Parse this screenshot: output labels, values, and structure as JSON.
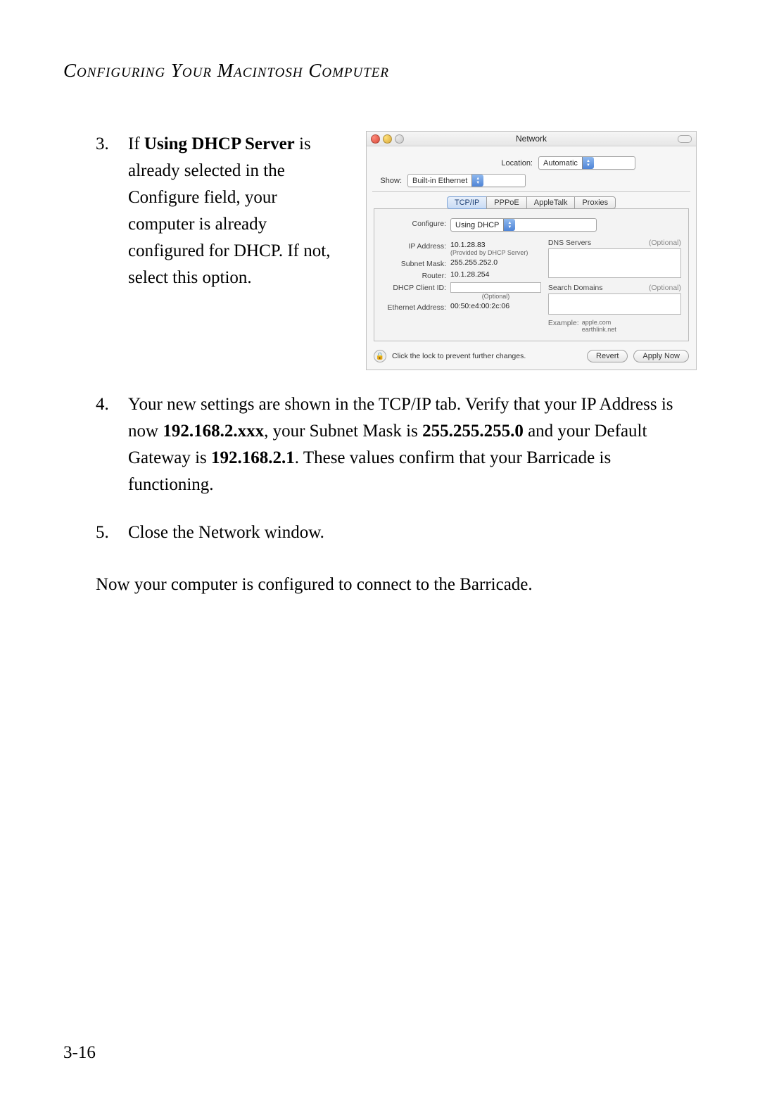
{
  "header": {
    "title": "Configuring Your Macintosh Computer"
  },
  "steps": {
    "s3": {
      "num": "3.",
      "lead": "If ",
      "bold": "Using DHCP Server",
      "rest": " is already selected in the Configure field, your computer is already configured for DHCP. If not, select this option."
    },
    "s4": {
      "num": "4.",
      "t1": "Your new settings are shown in the TCP/IP tab. Verify that your IP Address is now ",
      "b1": "192.168.2.xxx",
      "t2": ", your Subnet Mask is ",
      "b2": "255.255.255.0",
      "t3": " and your Default Gateway is ",
      "b3": "192.168.2.1",
      "t4": ". These values confirm that your Barricade is functioning."
    },
    "s5": {
      "num": "5.",
      "text": "Close the Network window."
    }
  },
  "closing": "Now your computer is configured to connect to the Barricade.",
  "pageNumber": "3-16",
  "mac": {
    "windowTitle": "Network",
    "location": {
      "label": "Location:",
      "value": "Automatic"
    },
    "show": {
      "label": "Show:",
      "value": "Built-in Ethernet"
    },
    "tabs": [
      "TCP/IP",
      "PPPoE",
      "AppleTalk",
      "Proxies"
    ],
    "configure": {
      "label": "Configure:",
      "value": "Using DHCP"
    },
    "ip": {
      "label": "IP Address:",
      "value": "10.1.28.83",
      "note": "(Provided by DHCP Server)"
    },
    "subnet": {
      "label": "Subnet Mask:",
      "value": "255.255.252.0"
    },
    "router": {
      "label": "Router:",
      "value": "10.1.28.254"
    },
    "dhcpClient": {
      "label": "DHCP Client ID:",
      "note": "(Optional)"
    },
    "ethernet": {
      "label": "Ethernet Address:",
      "value": "00:50:e4:00:2c:06"
    },
    "dns": {
      "label": "DNS Servers",
      "opt": "(Optional)"
    },
    "search": {
      "label": "Search Domains",
      "opt": "(Optional)"
    },
    "example": {
      "label": "Example:",
      "v1": "apple.com",
      "v2": "earthlink.net"
    },
    "lockText": "Click the lock to prevent further changes.",
    "buttons": {
      "revert": "Revert",
      "apply": "Apply Now"
    }
  }
}
